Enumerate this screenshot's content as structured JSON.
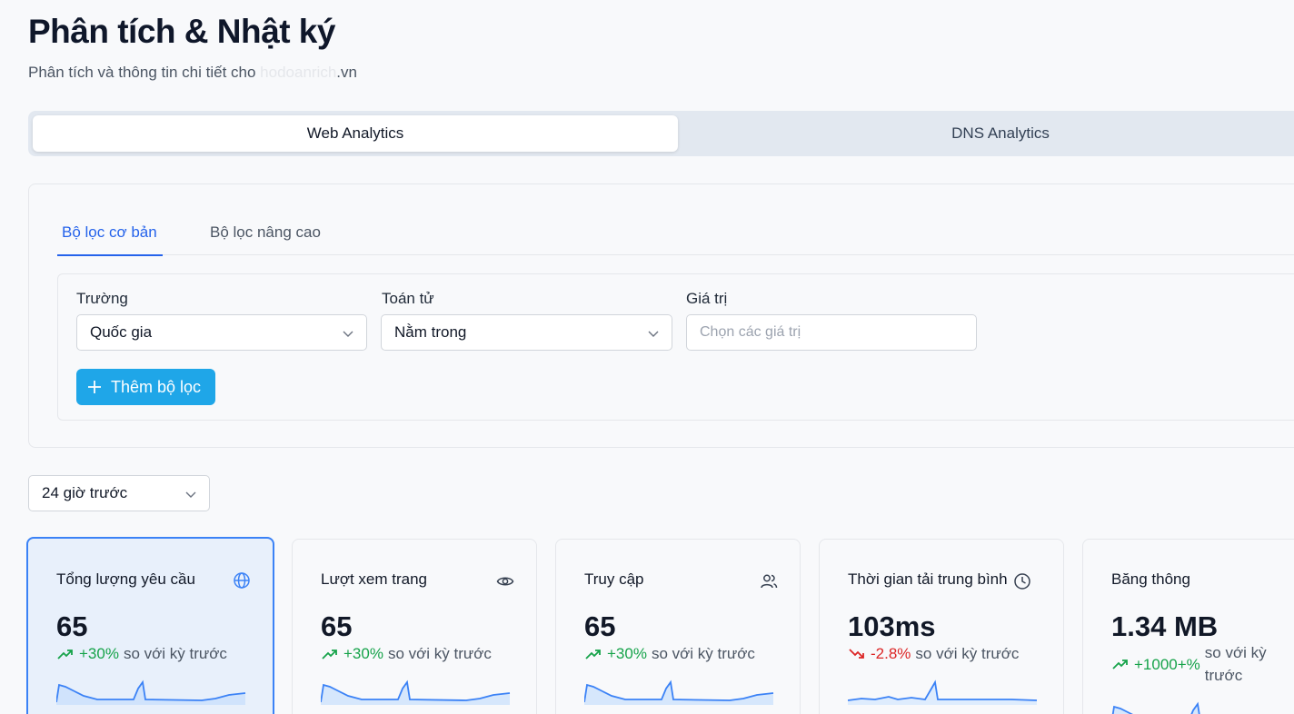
{
  "header": {
    "title": "Phân tích & Nhật ký",
    "subtitle_prefix": "Phân tích và thông tin chi tiết cho ",
    "subtitle_masked": "hodoanrich",
    "subtitle_suffix": ".vn"
  },
  "main_tabs": [
    {
      "label": "Web Analytics",
      "active": true
    },
    {
      "label": "DNS Analytics",
      "active": false
    }
  ],
  "filter_tabs": [
    {
      "label": "Bộ lọc cơ bản",
      "active": true
    },
    {
      "label": "Bộ lọc nâng cao",
      "active": false
    }
  ],
  "filter": {
    "field_label": "Trường",
    "field_value": "Quốc gia",
    "operator_label": "Toán tử",
    "operator_value": "Nằm trong",
    "value_label": "Giá trị",
    "value_placeholder": "Chọn các giá trị",
    "add_button": "Thêm bộ lọc"
  },
  "time_range": "24 giờ trước",
  "compare_text": "so với kỳ trước",
  "colors": {
    "accent": "#2563eb",
    "button": "#1fa6e8",
    "up": "#16a34a",
    "down": "#dc2626",
    "spark": "#3b82f6"
  },
  "metrics": [
    {
      "title": "Tổng lượng yêu cầu",
      "icon": "globe-icon",
      "value": "65",
      "change": "+30%",
      "trend": "up",
      "selected": true
    },
    {
      "title": "Lượt xem trang",
      "icon": "eye-icon",
      "value": "65",
      "change": "+30%",
      "trend": "up",
      "selected": false
    },
    {
      "title": "Truy cập",
      "icon": "users-icon",
      "value": "65",
      "change": "+30%",
      "trend": "up",
      "selected": false
    },
    {
      "title": "Thời gian tải trung bình",
      "icon": "clock-icon",
      "value": "103ms",
      "change": "-2.8%",
      "trend": "down",
      "selected": false
    },
    {
      "title": "Băng thông",
      "icon": "monitor-icon",
      "value": "1.34 MB",
      "change": "+1000+%",
      "trend": "up",
      "selected": false
    }
  ]
}
